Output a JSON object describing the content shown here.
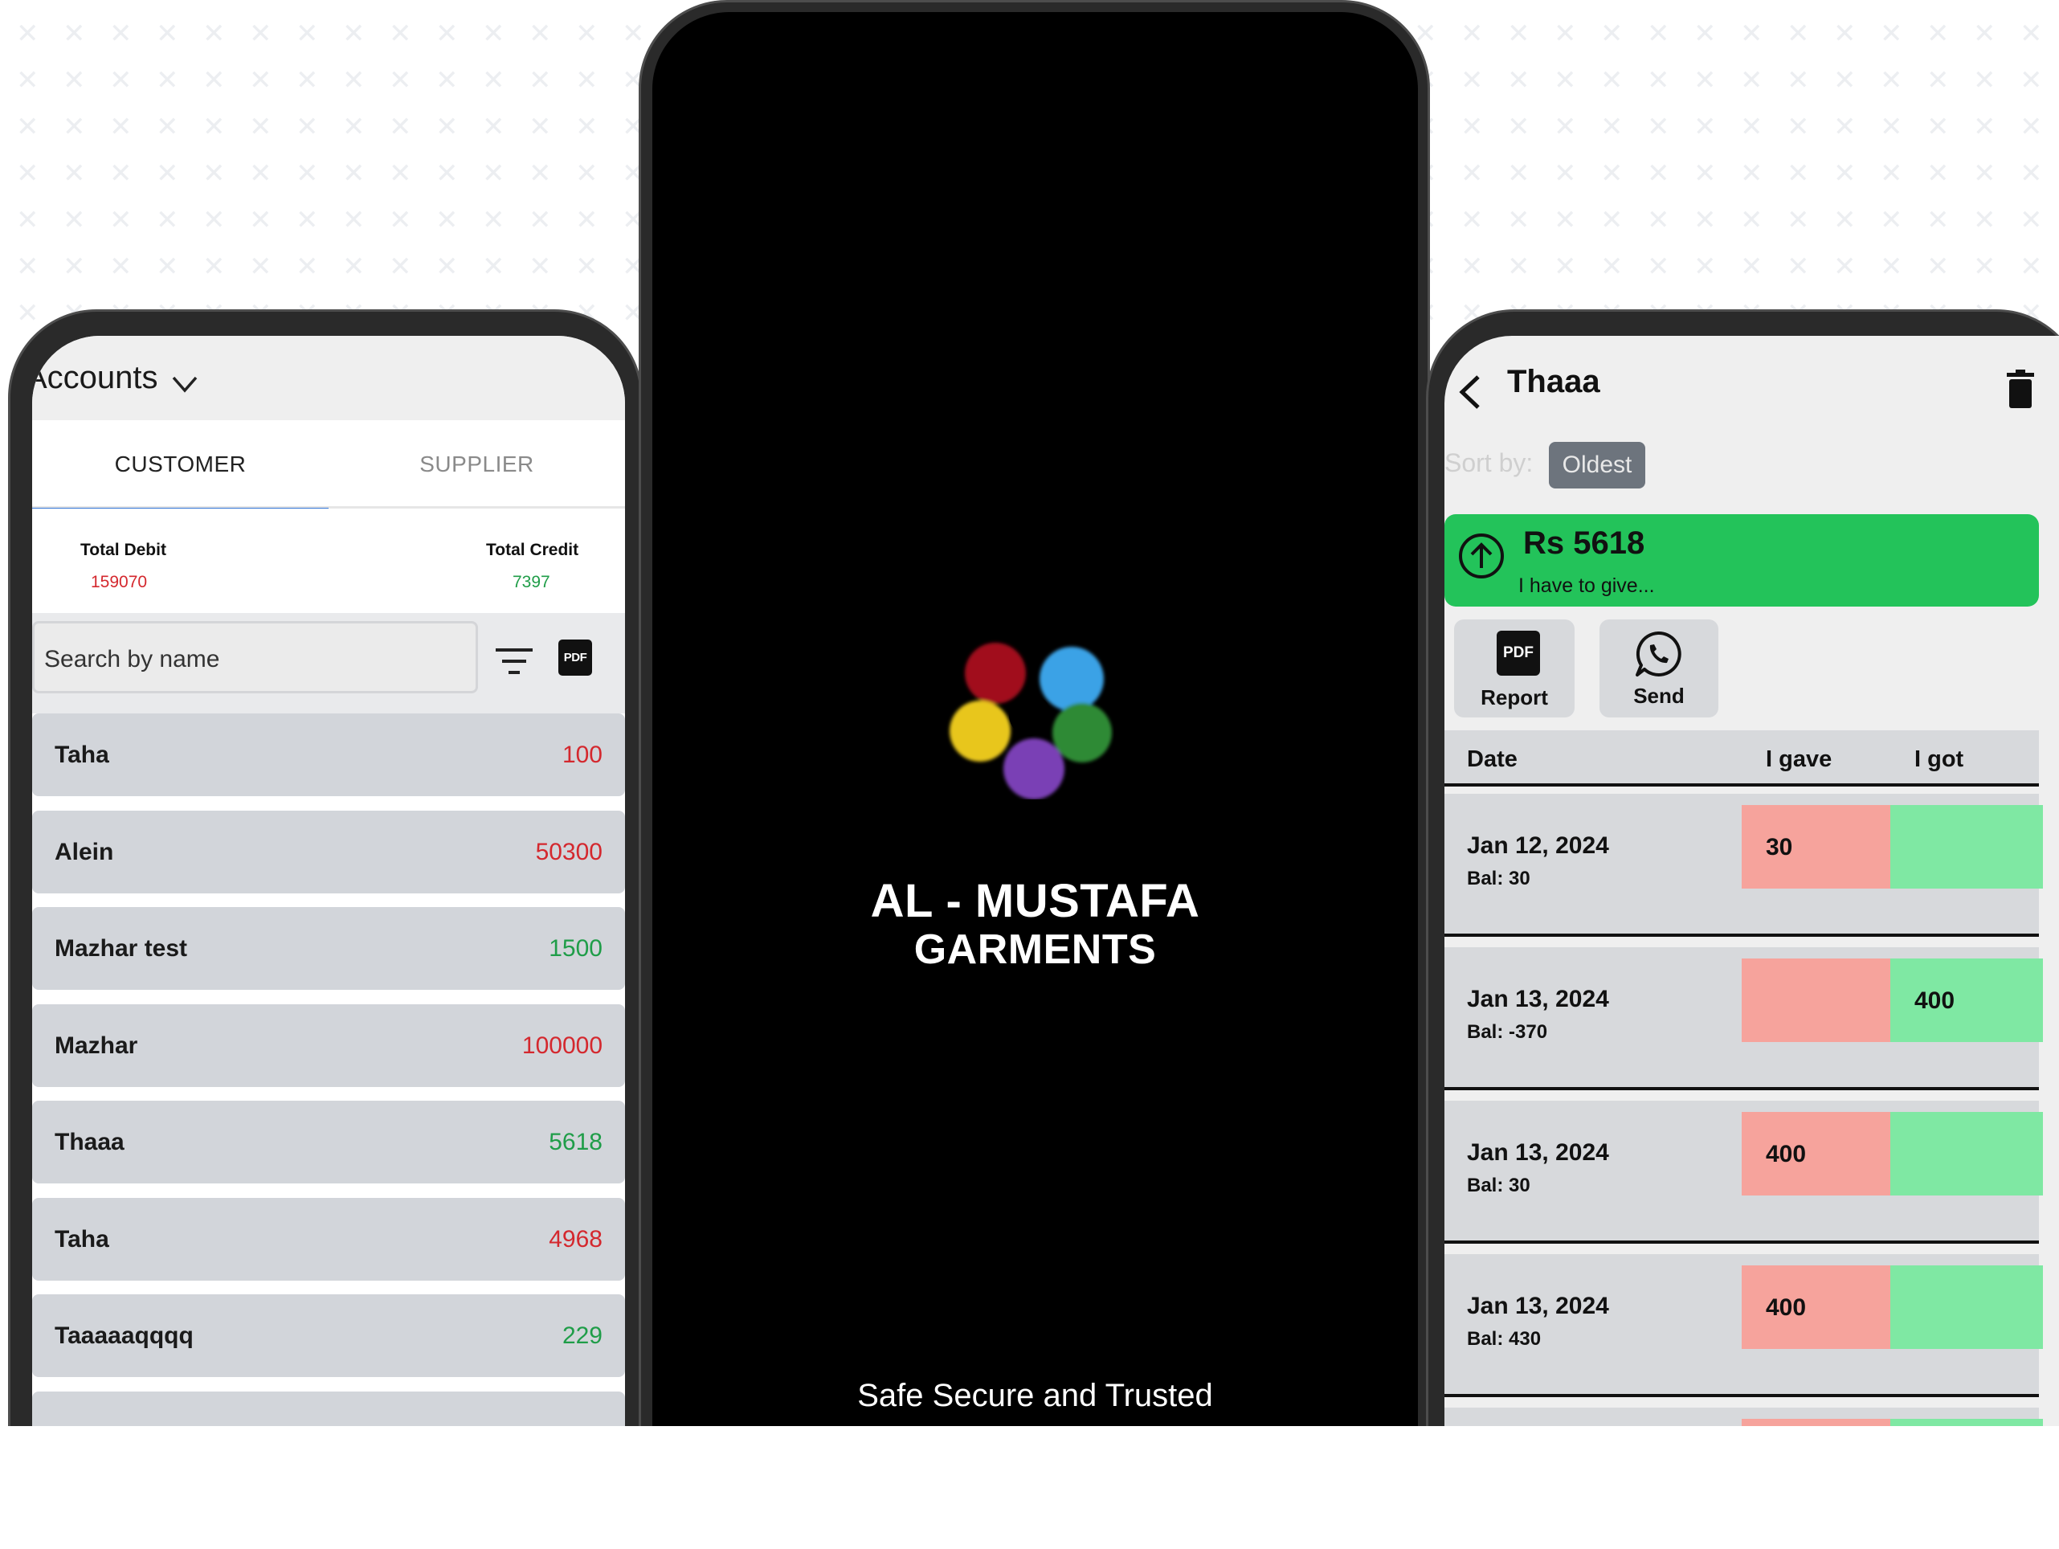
{
  "left_phone": {
    "header_title": "Accounts",
    "tabs": [
      {
        "label": "CUSTOMER",
        "active": true
      },
      {
        "label": "SUPPLIER",
        "active": false
      }
    ],
    "totals": {
      "debit_label": "Total Debit",
      "debit_value": "159070",
      "credit_label": "Total Credit",
      "credit_value": "7397"
    },
    "search": {
      "placeholder": "Search by name"
    },
    "pdf_icon_text": "PDF",
    "accounts": [
      {
        "name": "Taha",
        "amount": "100",
        "status": "debit"
      },
      {
        "name": "Alein",
        "amount": "50300",
        "status": "debit"
      },
      {
        "name": "Mazhar test",
        "amount": "1500",
        "status": "credit"
      },
      {
        "name": "Mazhar",
        "amount": "100000",
        "status": "debit"
      },
      {
        "name": "Thaaa",
        "amount": "5618",
        "status": "credit"
      },
      {
        "name": "Taha",
        "amount": "4968",
        "status": "debit"
      },
      {
        "name": "Taaaaaqqqq",
        "amount": "229",
        "status": "credit"
      }
    ]
  },
  "center_phone": {
    "brand_line1": "AL - MUSTAFA",
    "brand_line2": "GARMENTS",
    "tagline": "Safe Secure and Trusted"
  },
  "right_phone": {
    "title": "Thaaa",
    "sort_label": "Sort by:",
    "sort_value": "Oldest",
    "balance": {
      "amount": "Rs 5618",
      "note": "I have to give..."
    },
    "actions": {
      "report_label": "Report",
      "send_label": "Send",
      "pdf_text": "PDF"
    },
    "table_headers": {
      "date": "Date",
      "gave": "I gave",
      "got": "I got"
    },
    "transactions": [
      {
        "date": "Jan 12, 2024",
        "balance": "Bal: 30",
        "gave": "30",
        "got": ""
      },
      {
        "date": "Jan 13, 2024",
        "balance": "Bal: -370",
        "gave": "",
        "got": "400"
      },
      {
        "date": "Jan 13, 2024",
        "balance": "Bal: 30",
        "gave": "400",
        "got": ""
      },
      {
        "date": "Jan 13, 2024",
        "balance": "Bal: 430",
        "gave": "400",
        "got": ""
      }
    ]
  },
  "colors": {
    "debit_red": "#d4282e",
    "credit_green": "#1f9d48",
    "tab_accent": "#2f74d6",
    "balance_card_green": "#23c35a",
    "gave_cell": "#f6a39c",
    "got_cell": "#7fe8a3"
  }
}
